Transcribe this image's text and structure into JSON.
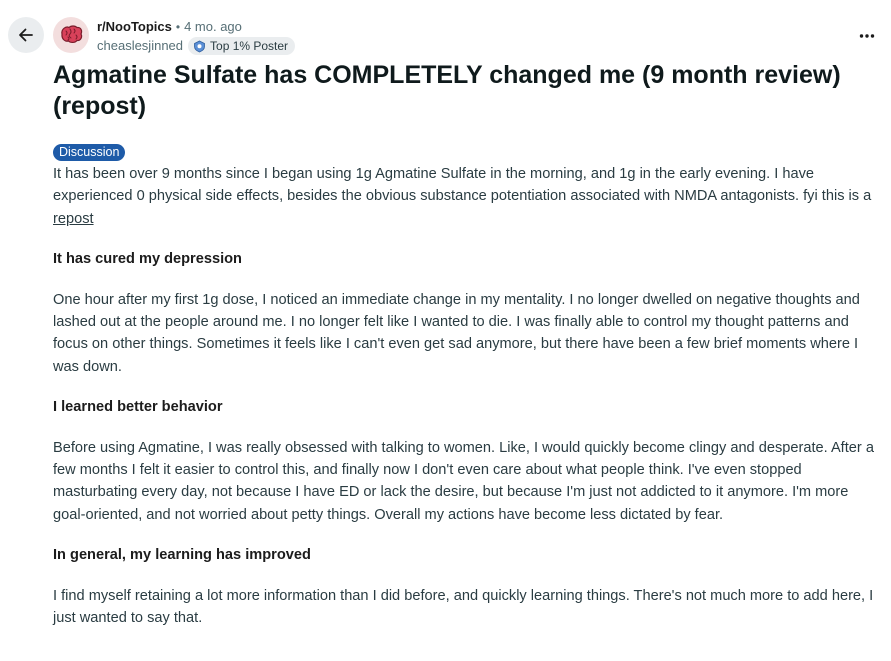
{
  "post": {
    "subreddit": "r/NooTopics",
    "separator": "•",
    "age": "4 mo. ago",
    "username": "cheaslesjinned",
    "user_flair": "Top 1% Poster",
    "title": "Agmatine Sulfate has COMPLETELY changed me (9 month review) (repost)",
    "post_flair": "Discussion",
    "flair_color": "#1e5ba8",
    "intro_text": "It has been over 9 months since I began using 1g Agmatine Sulfate in the morning, and 1g in the early evening. I have experienced 0 physical side effects, besides the obvious substance potentiation associated with NMDA antagonists. fyi this is a ",
    "intro_link": "repost",
    "sections": [
      {
        "heading": "It has cured my depression",
        "text": "One hour after my first 1g dose, I noticed an immediate change in my mentality. I no longer dwelled on negative thoughts and lashed out at the people around me. I no longer felt like I wanted to die. I was finally able to control my thought patterns and focus on other things. Sometimes it feels like I can't even get sad anymore, but there have been a few brief moments where I was down."
      },
      {
        "heading": "I learned better behavior",
        "text": "Before using Agmatine, I was really obsessed with talking to women. Like, I would quickly become clingy and desperate. After a few months I felt it easier to control this, and finally now I don't even care about what people think. I've even stopped masturbating every day, not because I have ED or lack the desire, but because I'm just not addicted to it anymore. I'm more goal-oriented, and not worried about petty things. Overall my actions have become less dictated by fear."
      },
      {
        "heading": "In general, my learning has improved",
        "text": "I find myself retaining a lot more information than I did before, and quickly learning things. There's not much more to add here, I just wanted to say that."
      }
    ]
  },
  "icons": {
    "back": "arrow-left-icon",
    "avatar": "brain-icon",
    "flair": "contributor-badge-icon",
    "more": "more-horizontal-icon"
  }
}
